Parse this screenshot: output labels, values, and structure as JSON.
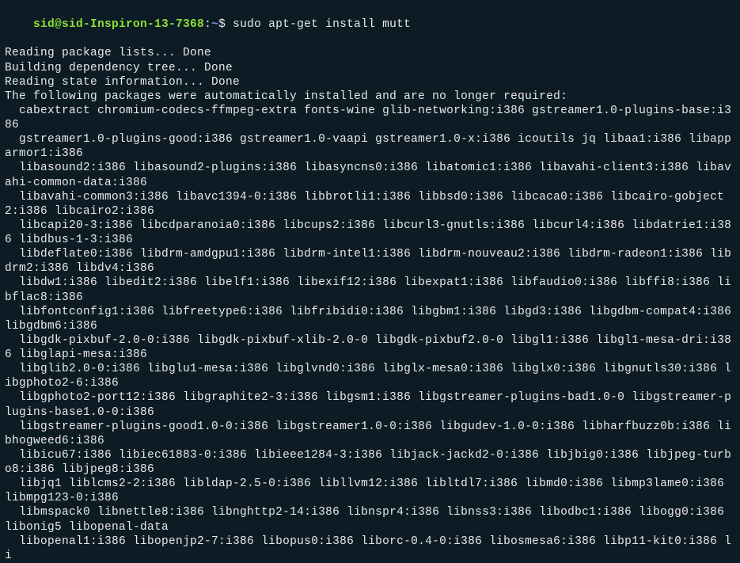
{
  "prompt": {
    "user_host": "sid@sid-Inspiron-13-7368",
    "colon": ":",
    "path": "~",
    "dollar": "$ ",
    "command": "sudo apt-get install mutt"
  },
  "output_lines": [
    "Reading package lists... Done",
    "Building dependency tree... Done",
    "Reading state information... Done",
    "The following packages were automatically installed and are no longer required:",
    "  cabextract chromium-codecs-ffmpeg-extra fonts-wine glib-networking:i386 gstreamer1.0-plugins-base:i386",
    "  gstreamer1.0-plugins-good:i386 gstreamer1.0-vaapi gstreamer1.0-x:i386 icoutils jq libaa1:i386 libapparmor1:i386",
    "  libasound2:i386 libasound2-plugins:i386 libasyncns0:i386 libatomic1:i386 libavahi-client3:i386 libavahi-common-data:i386",
    "  libavahi-common3:i386 libavc1394-0:i386 libbrotli1:i386 libbsd0:i386 libcaca0:i386 libcairo-gobject2:i386 libcairo2:i386",
    "  libcapi20-3:i386 libcdparanoia0:i386 libcups2:i386 libcurl3-gnutls:i386 libcurl4:i386 libdatrie1:i386 libdbus-1-3:i386",
    "  libdeflate0:i386 libdrm-amdgpu1:i386 libdrm-intel1:i386 libdrm-nouveau2:i386 libdrm-radeon1:i386 libdrm2:i386 libdv4:i386",
    "  libdw1:i386 libedit2:i386 libelf1:i386 libexif12:i386 libexpat1:i386 libfaudio0:i386 libffi8:i386 libflac8:i386",
    "  libfontconfig1:i386 libfreetype6:i386 libfribidi0:i386 libgbm1:i386 libgd3:i386 libgdbm-compat4:i386 libgdbm6:i386",
    "  libgdk-pixbuf-2.0-0:i386 libgdk-pixbuf-xlib-2.0-0 libgdk-pixbuf2.0-0 libgl1:i386 libgl1-mesa-dri:i386 libglapi-mesa:i386",
    "  libglib2.0-0:i386 libglu1-mesa:i386 libglvnd0:i386 libglx-mesa0:i386 libglx0:i386 libgnutls30:i386 libgphoto2-6:i386",
    "  libgphoto2-port12:i386 libgraphite2-3:i386 libgsm1:i386 libgstreamer-plugins-bad1.0-0 libgstreamer-plugins-base1.0-0:i386",
    "  libgstreamer-plugins-good1.0-0:i386 libgstreamer1.0-0:i386 libgudev-1.0-0:i386 libharfbuzz0b:i386 libhogweed6:i386",
    "  libicu67:i386 libiec61883-0:i386 libieee1284-3:i386 libjack-jackd2-0:i386 libjbig0:i386 libjpeg-turbo8:i386 libjpeg8:i386",
    "  libjq1 liblcms2-2:i386 libldap-2.5-0:i386 libllvm12:i386 libltdl7:i386 libmd0:i386 libmp3lame0:i386 libmpg123-0:i386",
    "  libmspack0 libnettle8:i386 libnghttp2-14:i386 libnspr4:i386 libnss3:i386 libodbc1:i386 libogg0:i386 libonig5 libopenal-data",
    "  libopenal1:i386 libopenjp2-7:i386 libopus0:i386 liborc-0.4-0:i386 libosmesa6:i386 libp11-kit0:i386 li"
  ]
}
